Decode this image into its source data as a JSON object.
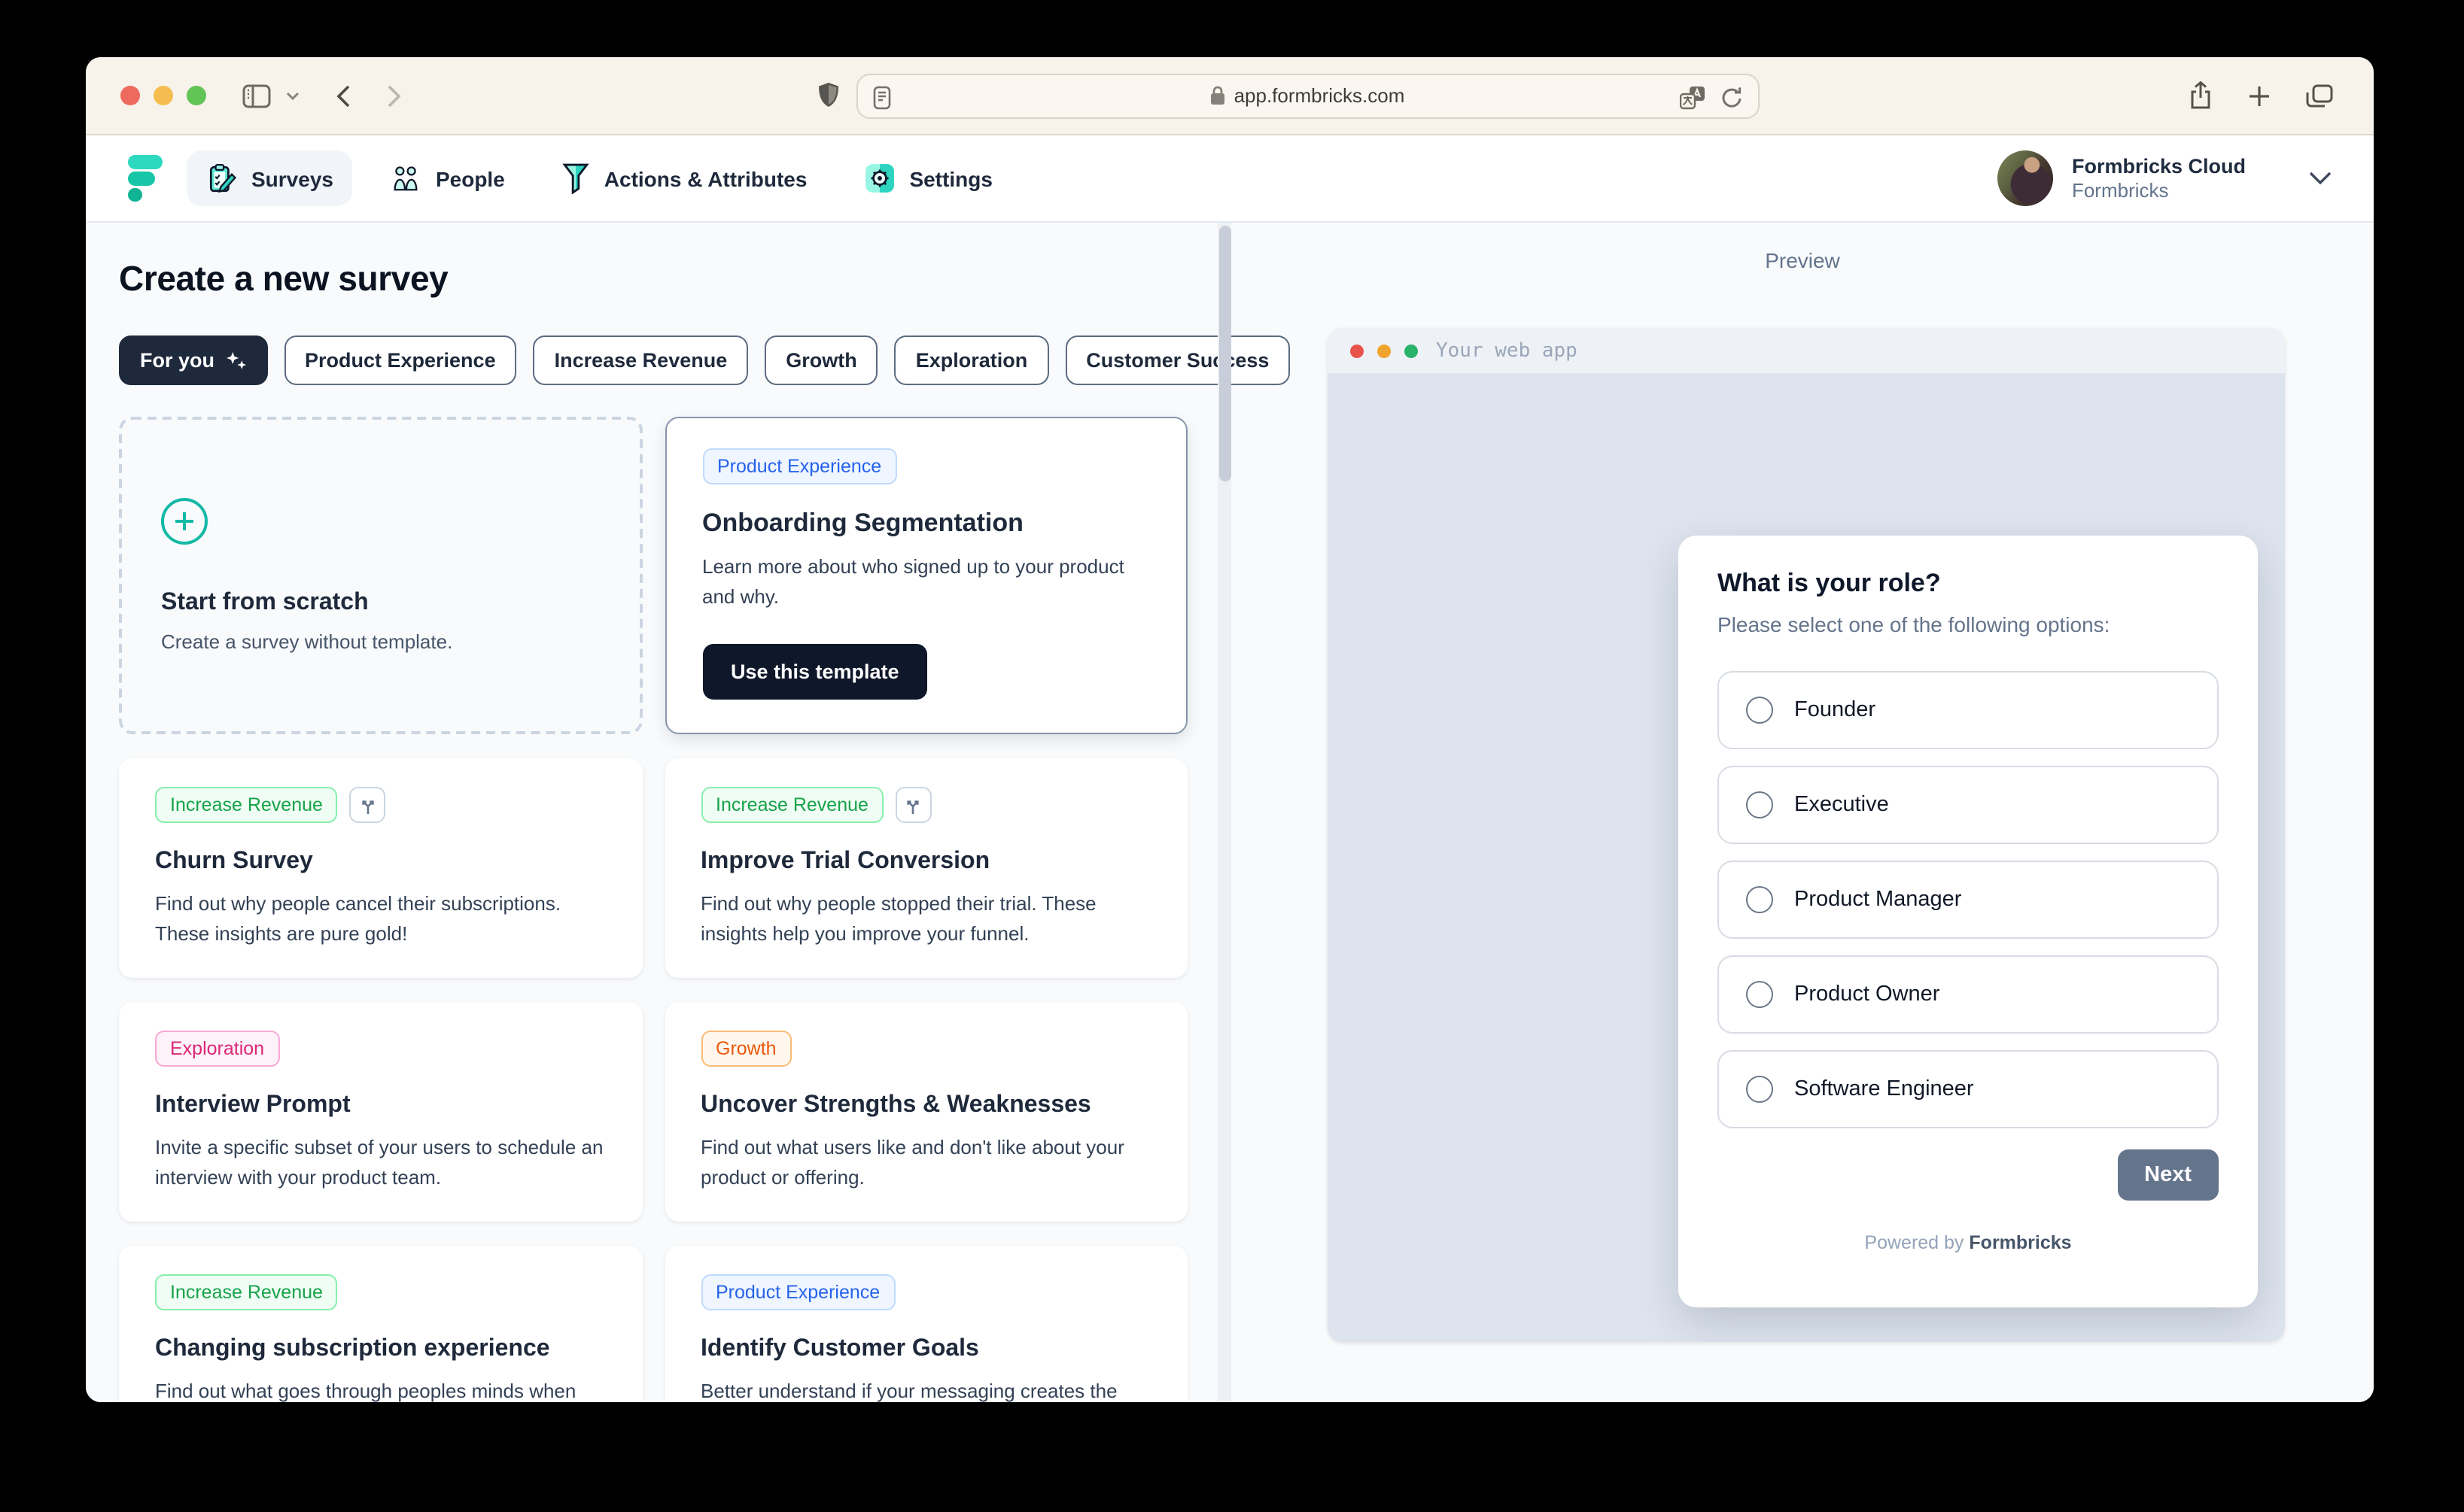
{
  "browser": {
    "url": "app.formbricks.com",
    "window_controls": [
      "close",
      "minimize",
      "zoom"
    ],
    "traffic_colors": {
      "close": "#ee6a5f",
      "minimize": "#f5bd4f",
      "zoom": "#61c455"
    }
  },
  "nav": {
    "items": [
      {
        "label": "Surveys",
        "icon": "clipboard-pencil-icon",
        "active": true
      },
      {
        "label": "People",
        "icon": "people-icon",
        "active": false
      },
      {
        "label": "Actions & Attributes",
        "icon": "funnel-icon",
        "active": false
      },
      {
        "label": "Settings",
        "icon": "gear-icon",
        "active": false
      }
    ],
    "account": {
      "name": "Formbricks Cloud",
      "org": "Formbricks"
    }
  },
  "main": {
    "title": "Create a new survey",
    "filters": [
      {
        "label": "For you",
        "active": true,
        "icon": "sparkles-icon"
      },
      {
        "label": "Product Experience",
        "active": false
      },
      {
        "label": "Increase Revenue",
        "active": false
      },
      {
        "label": "Growth",
        "active": false
      },
      {
        "label": "Exploration",
        "active": false
      },
      {
        "label": "Customer Success",
        "active": false
      }
    ],
    "scratch_card": {
      "title": "Start from scratch",
      "description": "Create a survey without template.",
      "icon": "plus-circle-icon"
    },
    "featured_template": {
      "badge": "Product Experience",
      "title": "Onboarding Segmentation",
      "description": "Learn more about who signed up to your product and why.",
      "button": "Use this template"
    },
    "templates": [
      {
        "badge": "Increase Revenue",
        "badge_color": "green",
        "has_branch_icon": true,
        "title": "Churn Survey",
        "description": "Find out why people cancel their subscriptions. These insights are pure gold!"
      },
      {
        "badge": "Increase Revenue",
        "badge_color": "green",
        "has_branch_icon": true,
        "title": "Improve Trial Conversion",
        "description": "Find out why people stopped their trial. These insights help you improve your funnel."
      },
      {
        "badge": "Exploration",
        "badge_color": "pink",
        "has_branch_icon": false,
        "title": "Interview Prompt",
        "description": "Invite a specific subset of your users to schedule an interview with your product team."
      },
      {
        "badge": "Growth",
        "badge_color": "orange",
        "has_branch_icon": false,
        "title": "Uncover Strengths & Weaknesses",
        "description": "Find out what users like and don't like about your product or offering."
      },
      {
        "badge": "Increase Revenue",
        "badge_color": "green",
        "has_branch_icon": false,
        "title": "Changing subscription experience",
        "description": "Find out what goes through peoples minds when changing their subscriptions."
      },
      {
        "badge": "Product Experience",
        "badge_color": "blue",
        "has_branch_icon": false,
        "title": "Identify Customer Goals",
        "description": "Better understand if your messaging creates the right expectations of the value your product"
      }
    ]
  },
  "preview": {
    "label": "Preview",
    "window_title": "Your web app",
    "question": "What is your role?",
    "subheader": "Please select one of the following options:",
    "options": [
      "Founder",
      "Executive",
      "Product Manager",
      "Product Owner",
      "Software Engineer"
    ],
    "next_button": "Next",
    "powered_by_prefix": "Powered by",
    "powered_by_brand": "Formbricks"
  },
  "colors": {
    "brand_teal": "#14b8a6",
    "dark_navy": "#0f172a",
    "page_background": "#f8fafc",
    "mock_body": "#dee4ee",
    "next_button": "#64748b",
    "badge_blue": "#2563eb",
    "badge_green": "#16a34a",
    "badge_pink": "#db2777",
    "badge_orange": "#ea580c"
  }
}
